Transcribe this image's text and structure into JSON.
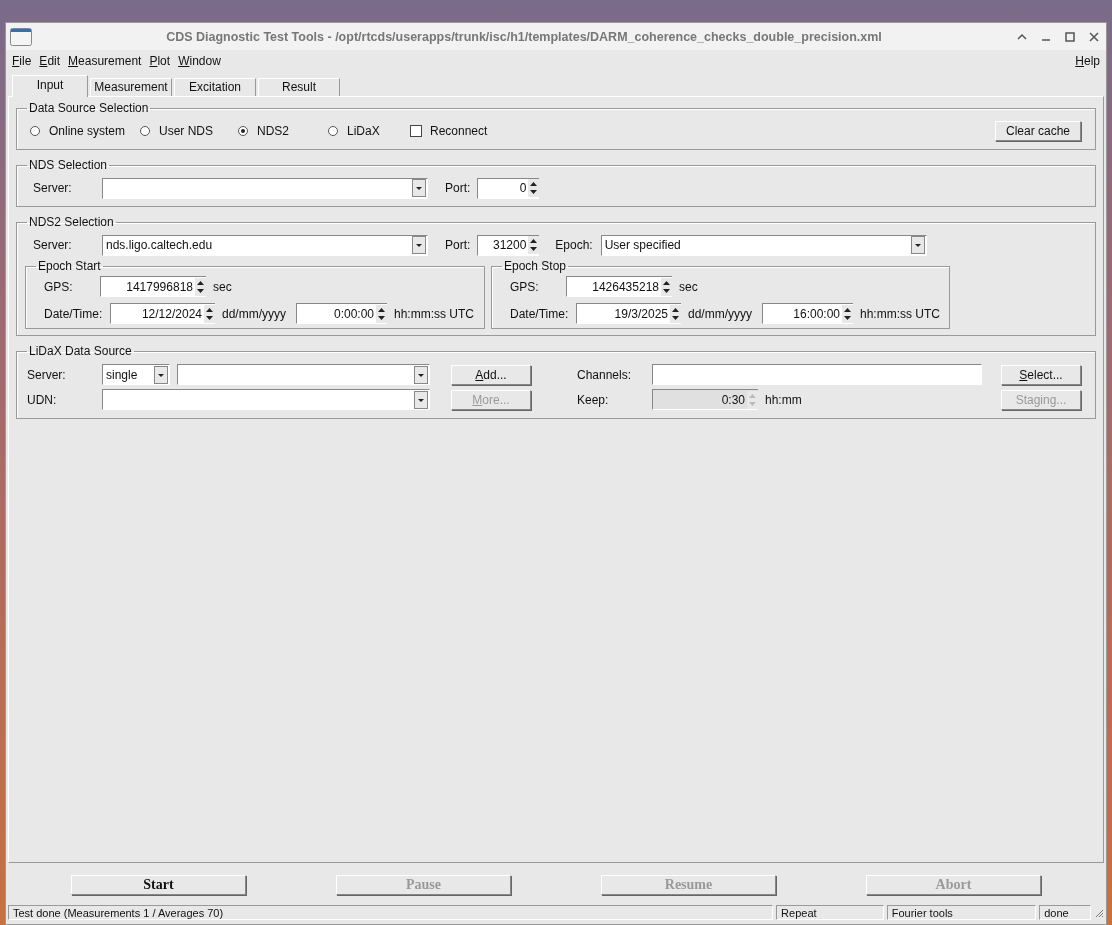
{
  "window": {
    "title": "CDS Diagnostic Test Tools - /opt/rtcds/userapps/trunk/isc/h1/templates/DARM_coherence_checks_double_precision.xml"
  },
  "menu": [
    {
      "label": "File"
    },
    {
      "label": "Edit"
    },
    {
      "label": "Measurement"
    },
    {
      "label": "Plot"
    },
    {
      "label": "Window"
    }
  ],
  "help": "Help",
  "tabs": [
    {
      "label": "Input",
      "selected": true
    },
    {
      "label": "Measurement",
      "selected": false
    },
    {
      "label": "Excitation",
      "selected": false
    },
    {
      "label": "Result",
      "selected": false
    }
  ],
  "data_source": {
    "title": "Data Source Selection",
    "options": [
      {
        "label": "Online system",
        "selected": false
      },
      {
        "label": "User NDS",
        "selected": false
      },
      {
        "label": "NDS2",
        "selected": true
      },
      {
        "label": "LiDaX",
        "selected": false
      }
    ],
    "reconnect": {
      "label": "Reconnect",
      "checked": false
    },
    "clear_cache": "Clear cache"
  },
  "nds": {
    "title": "NDS Selection",
    "server_label": "Server:",
    "port_label": "Port:",
    "port": "0"
  },
  "nds2": {
    "title": "NDS2 Selection",
    "server_label": "Server:",
    "server": "nds.ligo.caltech.edu",
    "port_label": "Port:",
    "port": "31200",
    "epoch_label": "Epoch:",
    "epoch": "User specified",
    "epochs": [
      {
        "title": "Epoch Start",
        "gps_label": "GPS:",
        "gps": "1417996818",
        "gps_unit": "sec",
        "date_label": "Date/Time:",
        "date": "12/12/2024",
        "date_unit": "dd/mm/yyyy",
        "time": "0:00:00",
        "time_unit": "hh:mm:ss UTC"
      },
      {
        "title": "Epoch Stop",
        "gps_label": "GPS:",
        "gps": "1426435218",
        "gps_unit": "sec",
        "date_label": "Date/Time:",
        "date": "19/3/2025",
        "date_unit": "dd/mm/yyyy",
        "time": "16:00:00",
        "time_unit": "hh:mm:ss UTC"
      }
    ]
  },
  "lidax": {
    "title": "LiDaX Data Source",
    "server_label": "Server:",
    "server_mode": "single",
    "udn_label": "UDN:",
    "add": {
      "label": "Add...",
      "disabled": false
    },
    "more": {
      "label": "More...",
      "disabled": true
    },
    "channels_label": "Channels:",
    "keep_label": "Keep:",
    "keep": {
      "value": "0:30",
      "disabled": true
    },
    "keep_unit": "hh:mm",
    "select": {
      "label": "Select...",
      "disabled": false
    },
    "staging": {
      "label": "Staging...",
      "disabled": true
    }
  },
  "actions": [
    {
      "label": "Start",
      "disabled": false
    },
    {
      "label": "Pause",
      "disabled": true
    },
    {
      "label": "Resume",
      "disabled": true
    },
    {
      "label": "Abort",
      "disabled": true
    }
  ],
  "status_bar": [
    "Test done (Measurements 1 / Averages 70)",
    "Repeat",
    "Fourier tools",
    "done"
  ]
}
